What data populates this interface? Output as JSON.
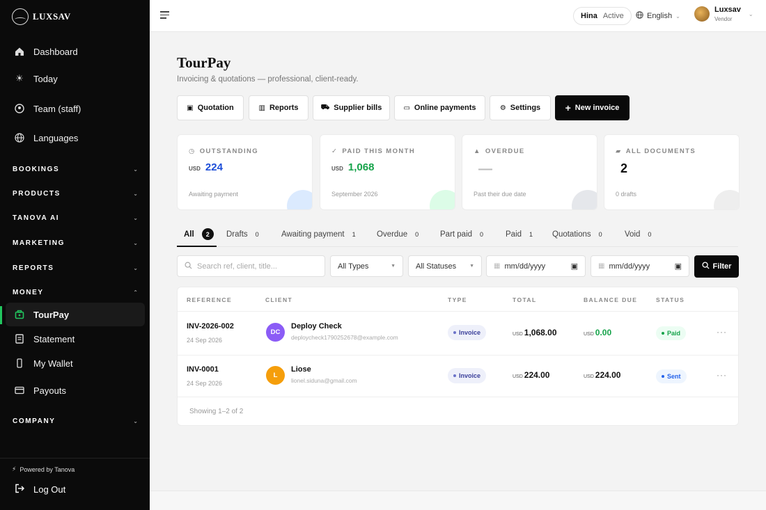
{
  "brand": {
    "name": "LUXSAV"
  },
  "sidebar": {
    "top_items": [
      {
        "label": "Dashboard",
        "icon": "home-icon"
      },
      {
        "label": "Today",
        "icon": "sun-icon"
      },
      {
        "label": "Team (staff)",
        "icon": "team-icon"
      },
      {
        "label": "Languages",
        "icon": "globe-icon"
      }
    ],
    "sections": [
      {
        "label": "BOOKINGS",
        "chev": "⌄"
      },
      {
        "label": "PRODUCTS",
        "chev": "⌄"
      },
      {
        "label": "TANOVA AI",
        "chev": "⌄"
      },
      {
        "label": "MARKETING",
        "chev": "⌄"
      },
      {
        "label": "REPORTS",
        "chev": "⌄"
      },
      {
        "label": "MONEY",
        "chev": "⌃"
      },
      {
        "label": "COMPANY",
        "chev": "⌄"
      }
    ],
    "money_items": [
      {
        "label": "TourPay",
        "icon": "briefcase-icon",
        "active": true
      },
      {
        "label": "Statement",
        "icon": "document-icon"
      },
      {
        "label": "My Wallet",
        "icon": "phone-icon"
      },
      {
        "label": "Payouts",
        "icon": "card-icon"
      }
    ],
    "powered_by": "Powered by Tanova",
    "logout": "Log Out",
    "accent": "#22c55e"
  },
  "topbar": {
    "status_name": "Hina",
    "status_text": "Active",
    "language": "English",
    "user_name": "Luxsav",
    "user_role": "Vendor"
  },
  "page": {
    "title": "TourPay",
    "subtitle": "Invoicing & quotations — professional, client-ready."
  },
  "actions": [
    {
      "label": "Quotation",
      "icon": "▣"
    },
    {
      "label": "Reports",
      "icon": "▥"
    },
    {
      "label": "Supplier bills",
      "icon": "⛟"
    },
    {
      "label": "Online payments",
      "icon": "▭"
    },
    {
      "label": "Settings",
      "icon": "⚙"
    },
    {
      "label": "New invoice",
      "icon": "+"
    }
  ],
  "stats": [
    {
      "title": "OUTSTANDING",
      "icon": "◷",
      "currency": "USD",
      "value": "224",
      "sub": "Awaiting payment",
      "color": "#1d4ed8",
      "blob": "#dbeafe"
    },
    {
      "title": "PAID THIS MONTH",
      "icon": "✓",
      "currency": "USD",
      "value": "1,068",
      "sub": "September 2026",
      "color": "#16a34a",
      "blob": "#dcfce7"
    },
    {
      "title": "OVERDUE",
      "icon": "▲",
      "currency": "",
      "value": "—",
      "sub": "Past their due date",
      "color": "#bbbbbb",
      "blob": "#e5e7eb"
    },
    {
      "title": "ALL DOCUMENTS",
      "icon": "▰",
      "currency": "",
      "value": "2",
      "sub": "0 drafts",
      "color": "#111111",
      "blob": "#eeeeee"
    }
  ],
  "tabs": [
    {
      "label": "All",
      "count": "2"
    },
    {
      "label": "Drafts",
      "count": "0"
    },
    {
      "label": "Awaiting payment",
      "count": "1"
    },
    {
      "label": "Overdue",
      "count": "0"
    },
    {
      "label": "Part paid",
      "count": "0"
    },
    {
      "label": "Paid",
      "count": "1"
    },
    {
      "label": "Quotations",
      "count": "0"
    },
    {
      "label": "Void",
      "count": "0"
    }
  ],
  "filters": {
    "search_placeholder": "Search ref, client, title...",
    "type_select": "All Types",
    "status_select": "All Statuses",
    "date_from": "mm/dd/yyyy",
    "date_to": "mm/dd/yyyy",
    "filter_label": "Filter"
  },
  "table": {
    "headers": [
      "REFERENCE",
      "CLIENT",
      "TYPE",
      "TOTAL",
      "BALANCE DUE",
      "STATUS"
    ],
    "rows": [
      {
        "ref": "INV-2026-002",
        "date": "24 Sep 2026",
        "initials": "DC",
        "avatar_color": "#8b5cf6",
        "client": "Deploy Check",
        "email": "deploycheck1790252678@example.com",
        "type": "Invoice",
        "currency": "USD",
        "total": "1,068.00",
        "balance": "0.00",
        "balance_color": "#16a34a",
        "status": "Paid",
        "status_bg": "#ecfdf3",
        "status_fg": "#16a34a"
      },
      {
        "ref": "INV-0001",
        "date": "24 Sep 2026",
        "initials": "L",
        "avatar_color": "#f59e0b",
        "client": "Liose",
        "email": "lionel.siduna@gmail.com",
        "type": "Invoice",
        "currency": "USD",
        "total": "224.00",
        "balance": "224.00",
        "balance_color": "#111111",
        "status": "Sent",
        "status_bg": "#eef5fe",
        "status_fg": "#2563eb"
      }
    ],
    "more": "···",
    "showing": "Showing 1–2 of 2"
  }
}
